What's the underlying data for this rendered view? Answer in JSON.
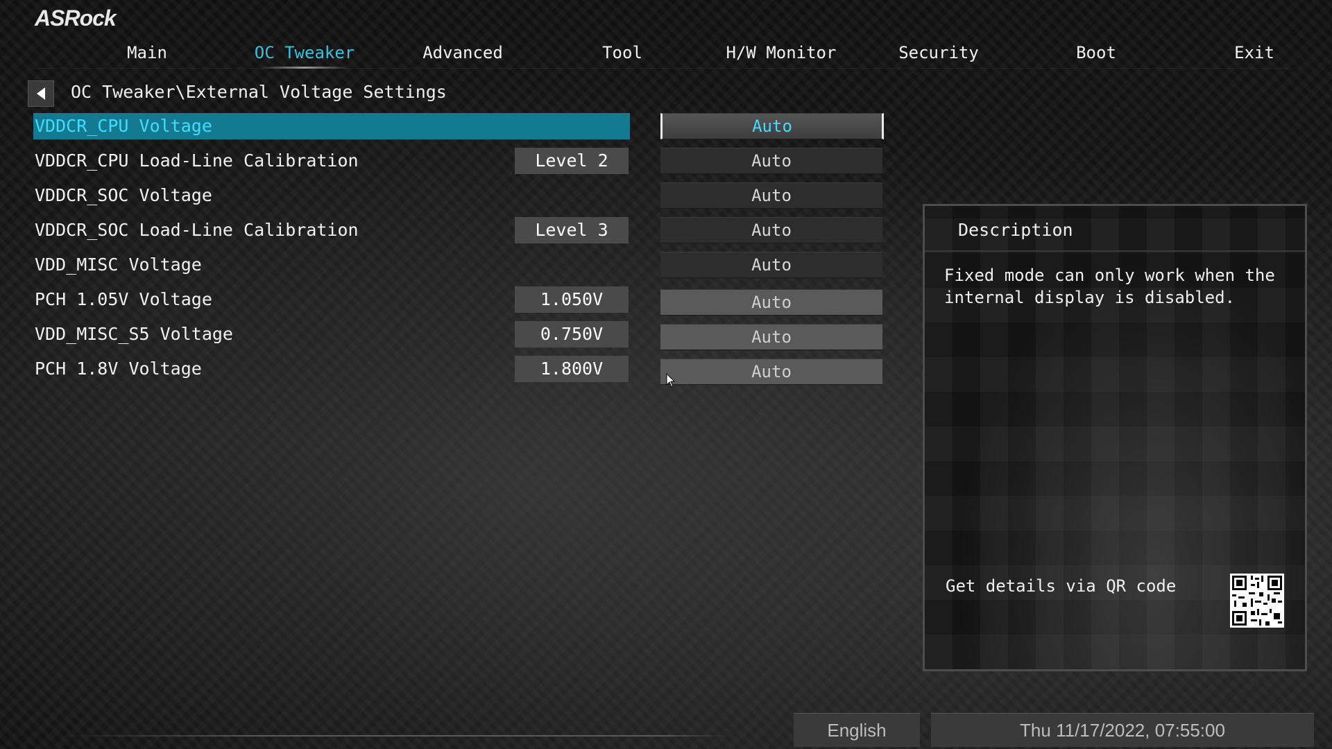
{
  "brand": {
    "logo_text": "ASRock"
  },
  "nav": {
    "tabs": [
      {
        "label": "Main"
      },
      {
        "label": "OC Tweaker",
        "active": true
      },
      {
        "label": "Advanced"
      },
      {
        "label": "Tool"
      },
      {
        "label": "H/W Monitor"
      },
      {
        "label": "Security"
      },
      {
        "label": "Boot"
      },
      {
        "label": "Exit"
      }
    ]
  },
  "breadcrumb": {
    "back_icon": "back-arrow-icon",
    "path": "OC Tweaker\\External Voltage Settings"
  },
  "settings": [
    {
      "label": "VDDCR_CPU Voltage",
      "current": "",
      "option": "Auto",
      "selected": true
    },
    {
      "label": "VDDCR_CPU Load-Line Calibration",
      "current": "Level 2",
      "option": "Auto"
    },
    {
      "label": "VDDCR_SOC Voltage",
      "current": "",
      "option": "Auto"
    },
    {
      "label": "VDDCR_SOC Load-Line Calibration",
      "current": "Level 3",
      "option": "Auto"
    },
    {
      "label": "VDD_MISC Voltage",
      "current": "",
      "option": "Auto"
    },
    {
      "label": "PCH 1.05V Voltage",
      "current": "1.050V",
      "option": "Auto"
    },
    {
      "label": "VDD_MISC_S5 Voltage",
      "current": "0.750V",
      "option": "Auto"
    },
    {
      "label": "PCH 1.8V Voltage",
      "current": "1.800V",
      "option": "Auto"
    }
  ],
  "description": {
    "title": "Description",
    "text": "Fixed mode can only work when the internal display is disabled.",
    "qr_label": "Get details via QR code",
    "qr_icon": "qr-code-icon"
  },
  "footer": {
    "language": "English",
    "datetime": "Thu 11/17/2022, 07:55:00"
  },
  "colors": {
    "accent": "#33c3e0",
    "selected_row": "#137a92",
    "selected_text": "#43dcff"
  }
}
